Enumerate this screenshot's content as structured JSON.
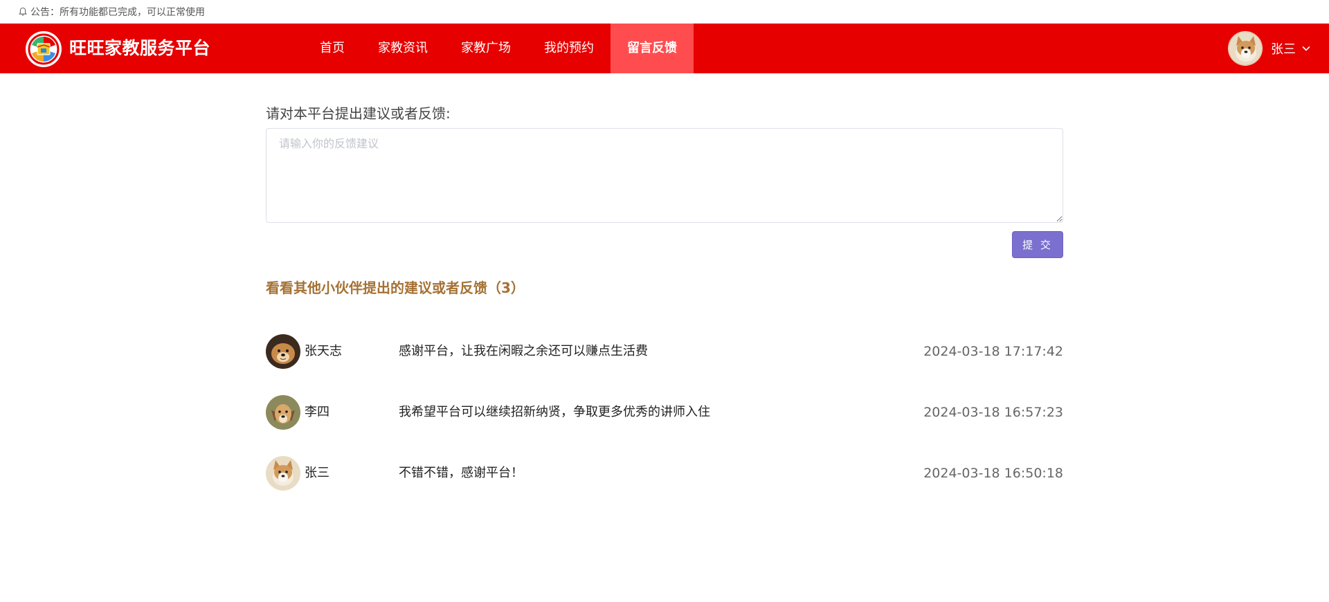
{
  "notice": {
    "icon": "bell-icon",
    "text": "公告：所有功能都已完成，可以正常使用"
  },
  "header": {
    "brand": "旺旺家教服务平台",
    "background": "#e60000",
    "active_background": "#ff4d4f",
    "nav": [
      {
        "label": "首页",
        "active": false
      },
      {
        "label": "家教资讯",
        "active": false
      },
      {
        "label": "家教广场",
        "active": false
      },
      {
        "label": "我的预约",
        "active": false
      },
      {
        "label": "留言反馈",
        "active": true
      }
    ],
    "user": {
      "name": "张三",
      "icon": "chevron-down-icon"
    }
  },
  "feedback": {
    "prompt": "请对本平台提出建议或者反馈:",
    "placeholder": "请输入你的反馈建议",
    "value": "",
    "submit_label": "提 交",
    "submit_color": "#7b6fcf"
  },
  "others": {
    "title": "看看其他小伙伴提出的建议或者反馈（3）",
    "title_color": "#a57134",
    "items": [
      {
        "name": "张天志",
        "content": "感谢平台，让我在闲暇之余还可以赚点生活费",
        "time": "2024-03-18 17:17:42"
      },
      {
        "name": "李四",
        "content": "我希望平台可以继续招新纳贤，争取更多优秀的讲师入住",
        "time": "2024-03-18 16:57:23"
      },
      {
        "name": "张三",
        "content": "不错不错，感谢平台！",
        "time": "2024-03-18 16:50:18"
      }
    ]
  }
}
